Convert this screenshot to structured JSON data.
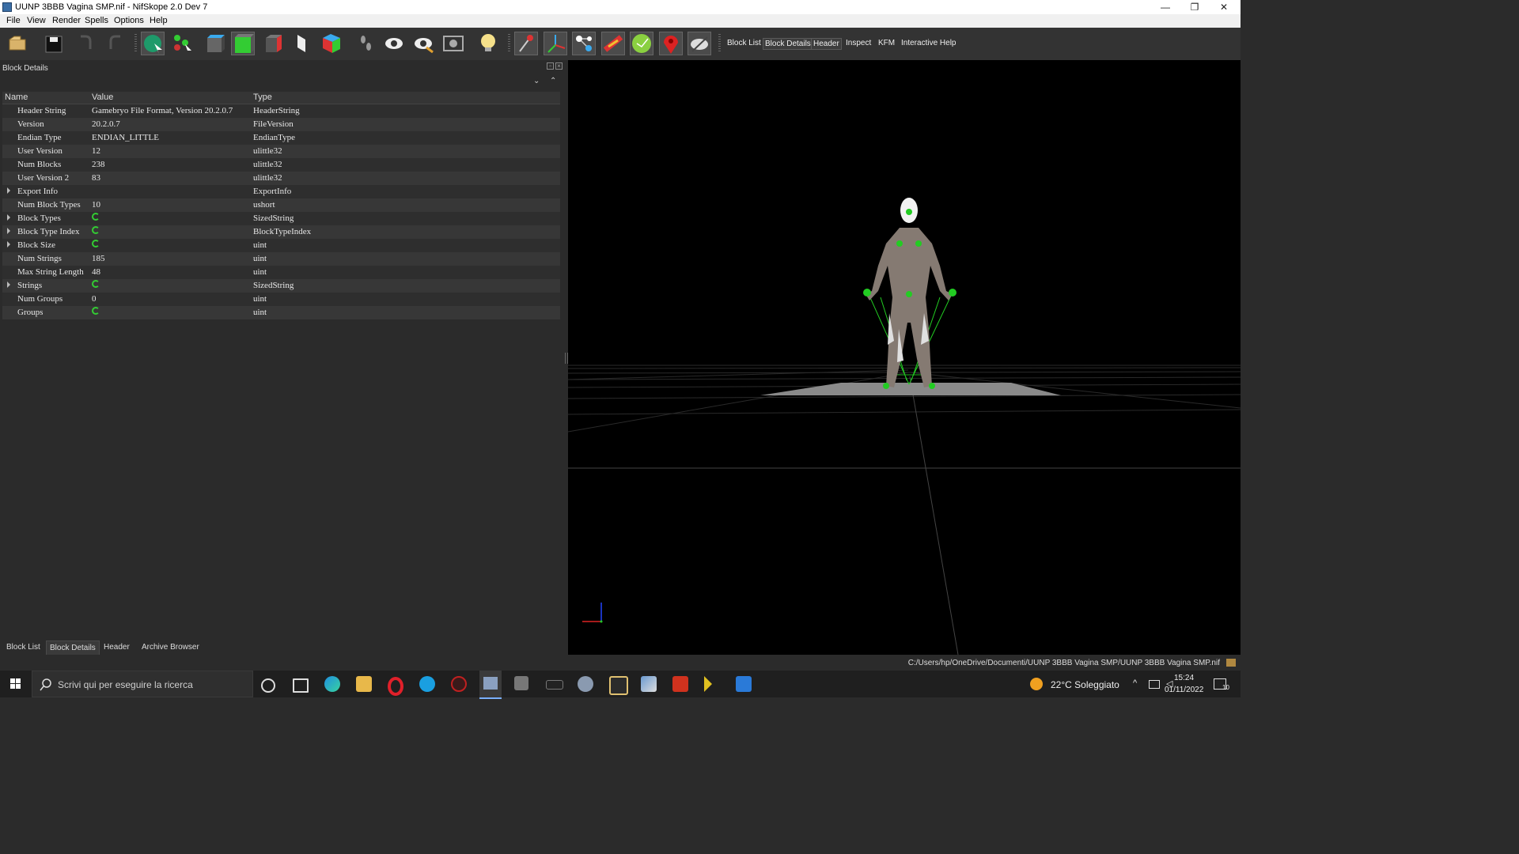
{
  "window": {
    "title": "UUNP 3BBB Vagina SMP.nif - NifSkope 2.0 Dev 7",
    "minimize": "—",
    "maximize": "❐",
    "close": "✕"
  },
  "menu": [
    "File",
    "View",
    "Render",
    "Spells",
    "Options",
    "Help"
  ],
  "toolbar": {
    "tabs": [
      {
        "label": "Block List",
        "active": false
      },
      {
        "label": "Block Details",
        "active": true
      },
      {
        "label": "Header",
        "active": true
      },
      {
        "label": "Inspect",
        "active": false
      },
      {
        "label": "KFM",
        "active": false
      },
      {
        "label": "Interactive Help",
        "active": false
      }
    ],
    "icons": [
      "load-icon",
      "save-icon",
      "undo-icon",
      "redo-icon",
      "select-object-icon",
      "select-vertex-icon",
      "view-top-icon",
      "view-front-icon",
      "view-side-icon",
      "view-walk-icon",
      "view-user-icon",
      "footsteps-icon",
      "eye-icon",
      "eye-visible-icon",
      "screenshot-icon",
      "lightbulb-icon",
      "pin-icon",
      "axes-icon",
      "nodes-icon",
      "glow-icon",
      "green-sphere-icon",
      "marker-icon",
      "hidden-eye-icon"
    ]
  },
  "block_details": {
    "panel_title": "Block Details",
    "columns": [
      "Name",
      "Value",
      "Type"
    ],
    "rows": [
      {
        "name": "Header String",
        "value": "Gamebryo File Format, Version 20.2.0.7",
        "type": "HeaderString",
        "expandable": false,
        "refresh": false
      },
      {
        "name": "Version",
        "value": "20.2.0.7",
        "type": "FileVersion",
        "expandable": false,
        "refresh": false
      },
      {
        "name": "Endian Type",
        "value": "ENDIAN_LITTLE",
        "type": "EndianType",
        "expandable": false,
        "refresh": false
      },
      {
        "name": "User Version",
        "value": "12",
        "type": "ulittle32",
        "expandable": false,
        "refresh": false
      },
      {
        "name": "Num Blocks",
        "value": "238",
        "type": "ulittle32",
        "expandable": false,
        "refresh": false
      },
      {
        "name": "User Version 2",
        "value": "83",
        "type": "ulittle32",
        "expandable": false,
        "refresh": false
      },
      {
        "name": "Export Info",
        "value": "",
        "type": "ExportInfo",
        "expandable": true,
        "refresh": false
      },
      {
        "name": "Num Block Types",
        "value": "10",
        "type": "ushort",
        "expandable": false,
        "refresh": false
      },
      {
        "name": "Block Types",
        "value": "",
        "type": "SizedString",
        "expandable": true,
        "refresh": true
      },
      {
        "name": "Block Type Index",
        "value": "",
        "type": "BlockTypeIndex",
        "expandable": true,
        "refresh": true
      },
      {
        "name": "Block Size",
        "value": "",
        "type": "uint",
        "expandable": true,
        "refresh": true
      },
      {
        "name": "Num Strings",
        "value": "185",
        "type": "uint",
        "expandable": false,
        "refresh": false
      },
      {
        "name": "Max String Length",
        "value": "48",
        "type": "uint",
        "expandable": false,
        "refresh": false
      },
      {
        "name": "Strings",
        "value": "",
        "type": "SizedString",
        "expandable": true,
        "refresh": true
      },
      {
        "name": "Num Groups",
        "value": "0",
        "type": "uint",
        "expandable": false,
        "refresh": false
      },
      {
        "name": "Groups",
        "value": "",
        "type": "uint",
        "expandable": false,
        "refresh": true
      }
    ]
  },
  "bottom_tabs": [
    {
      "label": "Block List",
      "active": false
    },
    {
      "label": "Block Details",
      "active": true
    },
    {
      "label": "Header",
      "active": false
    },
    {
      "label": "Archive Browser",
      "active": false
    }
  ],
  "status": {
    "path": "C:/Users/hp/OneDrive/Documenti/UUNP 3BBB Vagina SMP/UUNP 3BBB Vagina SMP.nif"
  },
  "taskbar": {
    "search_placeholder": "Scrivi qui per eseguire la ricerca",
    "weather": "22°C Soleggiato",
    "time": "15:24",
    "date": "01/11/2022",
    "notifications": "10"
  },
  "colors": {
    "toolbar_bg": "#333333",
    "panel_bg": "#2b2b2b",
    "viewport_bg": "#000000",
    "accent_green": "#33cc33",
    "taskbar_bg": "#1f1f1f"
  }
}
